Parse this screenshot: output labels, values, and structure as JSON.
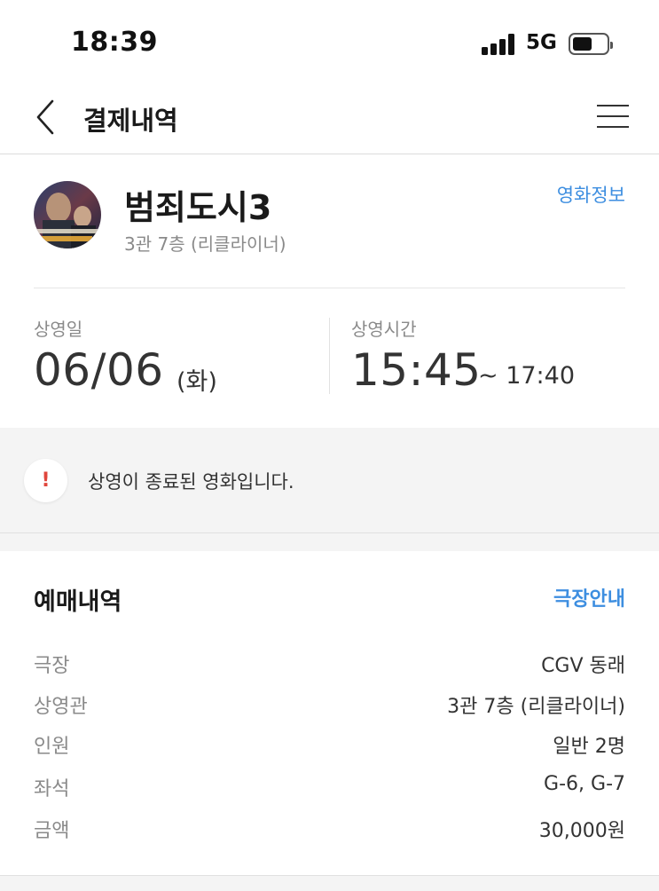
{
  "status_bar": {
    "time": "18:39",
    "network": "5G"
  },
  "nav": {
    "title": "결제내역"
  },
  "movie": {
    "title": "범죄도시3",
    "hall": "3관 7층 (리클라이너)",
    "info_link": "영화정보"
  },
  "schedule": {
    "date_label": "상영일",
    "date": "06/06",
    "weekday": "(화)",
    "time_label": "상영시간",
    "start": "15:45",
    "end": "~ 17:40"
  },
  "notice": {
    "icon": "!",
    "text": "상영이 종료된 영화입니다."
  },
  "booking": {
    "title": "예매내역",
    "theater_link": "극장안내",
    "rows": [
      {
        "label": "극장",
        "value": "CGV 동래"
      },
      {
        "label": "상영관",
        "value": "3관 7층 (리클라이너)"
      },
      {
        "label": "인원",
        "value": "일반 2명"
      },
      {
        "label": "좌석",
        "value": "G-6, G-7"
      },
      {
        "label": "금액",
        "value": "30,000원"
      }
    ]
  }
}
